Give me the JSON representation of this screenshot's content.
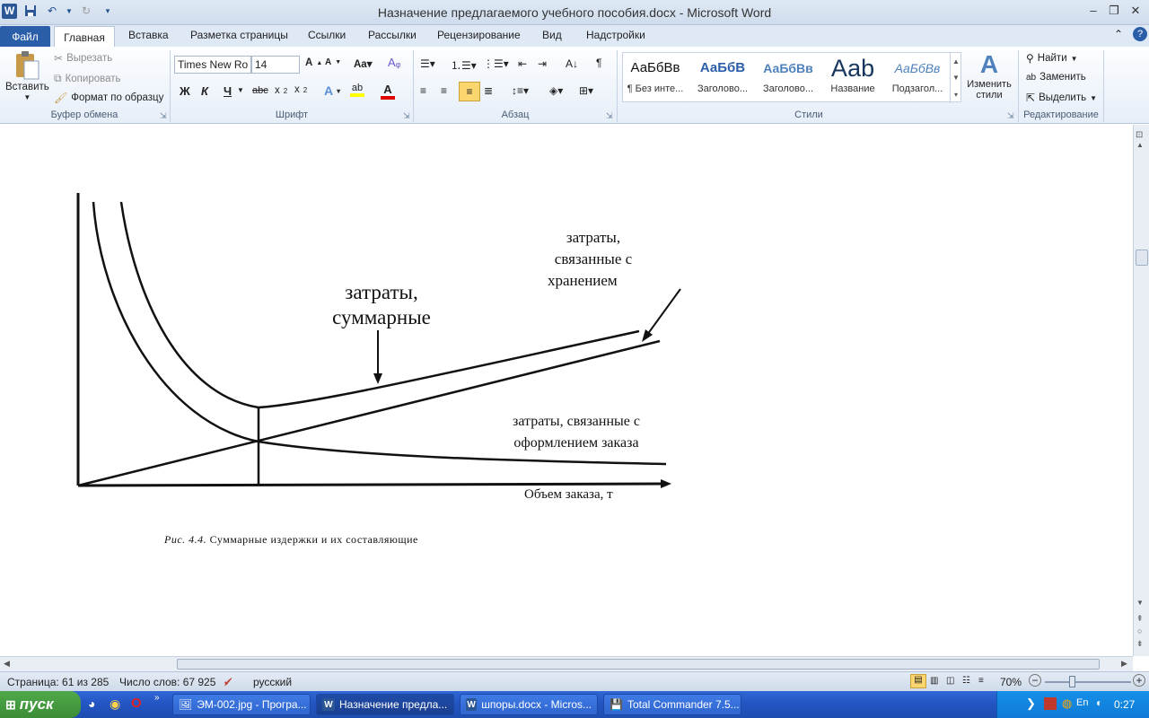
{
  "window": {
    "title": "Назначение предлагаемого учебного пособия.docx - Microsoft Word"
  },
  "tabs": [
    "Файл",
    "Главная",
    "Вставка",
    "Разметка страницы",
    "Ссылки",
    "Рассылки",
    "Рецензирование",
    "Вид",
    "Надстройки"
  ],
  "ribbon": {
    "clipboard": {
      "paste": "Вставить",
      "cut": "Вырезать",
      "copy": "Копировать",
      "format_painter": "Формат по образцу",
      "label": "Буфер обмена"
    },
    "font": {
      "name": "Times New Ro",
      "size": "14",
      "label": "Шрифт",
      "bold": "Ж",
      "italic": "К",
      "underline": "Ч"
    },
    "paragraph": {
      "label": "Абзац"
    },
    "styles": {
      "label": "Стили",
      "items": [
        {
          "preview": "АаБбВв",
          "name": "¶ Без инте..."
        },
        {
          "preview": "АаБбВ",
          "name": "Заголово..."
        },
        {
          "preview": "АаБбВв",
          "name": "Заголово..."
        },
        {
          "preview": "Ааb",
          "name": "Название"
        },
        {
          "preview": "АаБбВв",
          "name": "Подзагол..."
        }
      ],
      "change": "Изменить стили"
    },
    "editing": {
      "label": "Редактирование",
      "find": "Найти",
      "replace": "Заменить",
      "select": "Выделить"
    }
  },
  "figure": {
    "label_total": [
      "затраты,",
      "суммарные"
    ],
    "label_storage": [
      "затраты,",
      "связанные  с",
      "хранением"
    ],
    "label_ordering": [
      "затраты,  связанные  с",
      "оформлением заказа"
    ],
    "x_axis": "Объем заказа, т",
    "caption_prefix": "Рис. 4.4.",
    "caption_text": "Суммарные  издержки  и  их  составляющие"
  },
  "status": {
    "page": "Страница: 61 из 285",
    "words": "Число слов: 67 925",
    "language": "русский",
    "zoom": "70%"
  },
  "taskbar": {
    "start": "пуск",
    "tasks": [
      "ЭМ-002.jpg - Програ...",
      "Назначение предла...",
      "шпоры.docx - Micros...",
      "Total Commander 7.5..."
    ],
    "lang": "EN",
    "clock": "0:27"
  },
  "colors": {
    "accent": "#2a5ea9",
    "taskbar": "#2457c5",
    "start": "#3c8d36"
  }
}
